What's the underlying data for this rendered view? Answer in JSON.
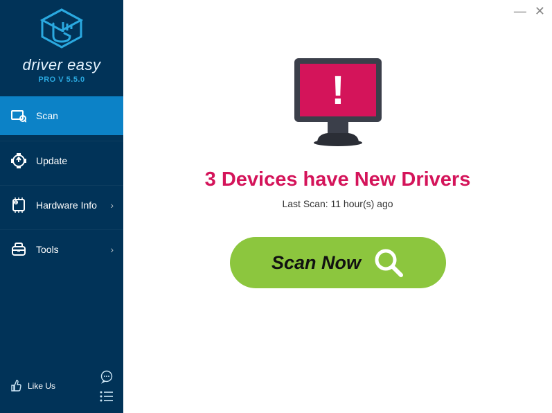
{
  "brand": {
    "name": "driver easy",
    "version_line": "PRO V 5.5.0"
  },
  "window": {
    "minimize": "—",
    "close": "✕"
  },
  "sidebar": {
    "items": [
      {
        "label": "Scan",
        "icon": "scan-icon",
        "active": true,
        "chevron": false
      },
      {
        "label": "Update",
        "icon": "update-icon",
        "active": false,
        "chevron": false
      },
      {
        "label": "Hardware Info",
        "icon": "hardware-info-icon",
        "active": false,
        "chevron": true
      },
      {
        "label": "Tools",
        "icon": "tools-icon",
        "active": false,
        "chevron": true
      }
    ],
    "like_us": "Like Us"
  },
  "main": {
    "headline": "3 Devices have New Drivers",
    "last_scan": "Last Scan: 11 hour(s) ago",
    "scan_button": "Scan Now"
  },
  "colors": {
    "sidebar_bg": "#013358",
    "sidebar_active": "#0c82c7",
    "headline": "#d4145a",
    "scan_btn": "#8cc63e",
    "brand_accent": "#2aa9e0"
  }
}
